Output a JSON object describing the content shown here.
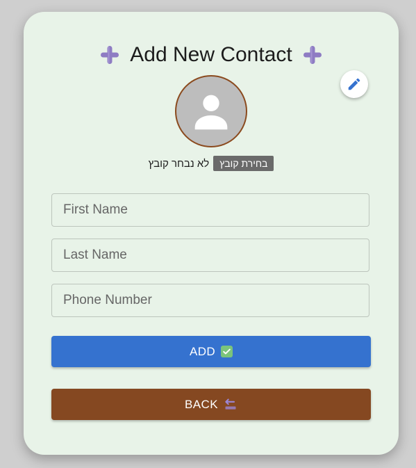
{
  "form": {
    "title": "Add New Contact",
    "file_button_label": "בחירת קובץ",
    "file_status": "לא נבחר קובץ",
    "fields": {
      "first_name_placeholder": "First Name",
      "last_name_placeholder": "Last Name",
      "phone_placeholder": "Phone Number"
    },
    "add_label": "ADD",
    "back_label": "BACK"
  },
  "colors": {
    "card_background": "#e8f3e8",
    "accent_plus": "#8e7cc3",
    "add_button": "#3572cf",
    "back_button": "#854821",
    "avatar_border": "#8b4a1e"
  },
  "icons": {
    "title_left": "plus-icon",
    "title_right": "plus-icon",
    "edit": "pencil-icon",
    "avatar": "person-icon",
    "add": "check-box-icon",
    "back": "back-arrow-icon"
  }
}
